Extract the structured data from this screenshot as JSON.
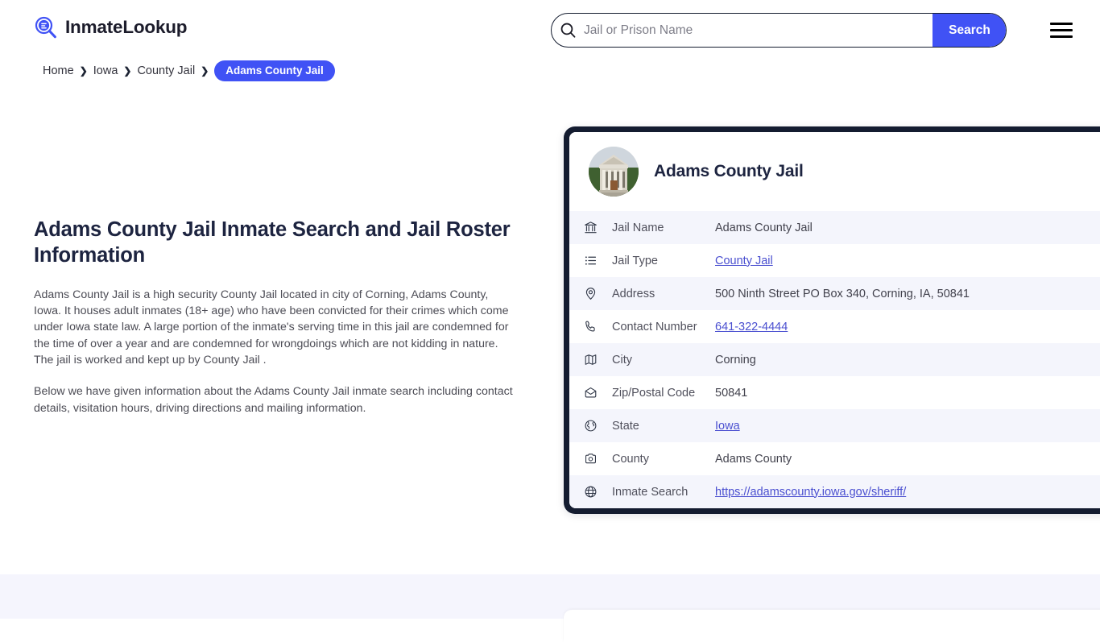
{
  "brand": {
    "name": "InmateLookup",
    "icon": "search-list-logo-icon",
    "accent": "#4052f5"
  },
  "search": {
    "placeholder": "Jail or Prison Name",
    "value": "",
    "button_label": "Search",
    "icon": "search-icon"
  },
  "menu": {
    "icon": "hamburger-menu-icon"
  },
  "breadcrumb": {
    "items": [
      {
        "label": "Home",
        "current": false
      },
      {
        "label": "Iowa",
        "current": false
      },
      {
        "label": "County Jail",
        "current": false
      },
      {
        "label": "Adams County Jail",
        "current": true
      }
    ],
    "separator": "❯"
  },
  "main": {
    "title": "Adams County Jail Inmate Search and Jail Roster Information",
    "paragraphs": [
      "Adams County Jail is a high security County Jail located in city of Corning, Adams County, Iowa. It houses adult inmates (18+ age) who have been convicted for their crimes which come under Iowa state law. A large portion of the inmate's serving time in this jail are condemned for the time of over a year and are condemned for wrongdoings which are not kidding in nature. The jail is worked and kept up by County Jail .",
      "Below we have given information about the Adams County Jail inmate search including contact details, visitation hours, driving directions and mailing information."
    ]
  },
  "info_card": {
    "title": "Adams County Jail",
    "avatar_alt": "courthouse-photo",
    "rows": [
      {
        "icon": "bank-building-icon",
        "label": "Jail Name",
        "value": "Adams County Jail",
        "link": false
      },
      {
        "icon": "list-icon",
        "label": "Jail Type",
        "value": "County Jail",
        "link": true
      },
      {
        "icon": "map-pin-icon",
        "label": "Address",
        "value": "500 Ninth Street PO Box 340, Corning, IA, 50841",
        "link": false
      },
      {
        "icon": "phone-icon",
        "label": "Contact Number",
        "value": "641-322-4444",
        "link": true
      },
      {
        "icon": "map-icon",
        "label": "City",
        "value": "Corning",
        "link": false
      },
      {
        "icon": "envelope-icon",
        "label": "Zip/Postal Code",
        "value": "50841",
        "link": false
      },
      {
        "icon": "globe-state-icon",
        "label": "State",
        "value": "Iowa",
        "link": true
      },
      {
        "icon": "county-image-icon",
        "label": "County",
        "value": "Adams County",
        "link": false
      },
      {
        "icon": "globe-icon",
        "label": "Inmate Search",
        "value": "https://adamscounty.iowa.gov/sheriff/",
        "link": true
      }
    ]
  }
}
